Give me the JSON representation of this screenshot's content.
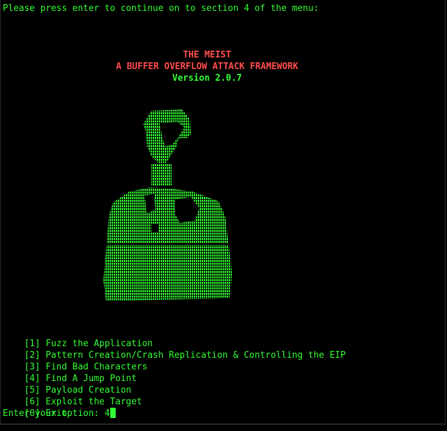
{
  "terminal": {
    "top_prompt": "Please press enter to continue on to section 4 of the menu:",
    "banner": {
      "title": "THE MEIST",
      "subtitle": "A BUFFER OVERFLOW ATTACK FRAMEWORK",
      "version": "Version 2.0.7"
    },
    "art_description_icon": "ascii-hooded-figure",
    "menu": [
      {
        "key": "[1]",
        "label": "Fuzz the Application"
      },
      {
        "key": "[2]",
        "label": "Pattern Creation/Crash Replication & Controlling the EIP"
      },
      {
        "key": "[3]",
        "label": "Find Bad Characters"
      },
      {
        "key": "[4]",
        "label": "Find A Jump Point"
      },
      {
        "key": "[5]",
        "label": "Payload Creation"
      },
      {
        "key": "[6]",
        "label": "Exploit the Target"
      },
      {
        "key": "[0]",
        "label": "Exit"
      }
    ],
    "input_prompt": "Enter your option: ",
    "input_value": "4"
  },
  "colors": {
    "background": "#000000",
    "text": "#33ff33",
    "banner_red": "#ff4d4d"
  }
}
